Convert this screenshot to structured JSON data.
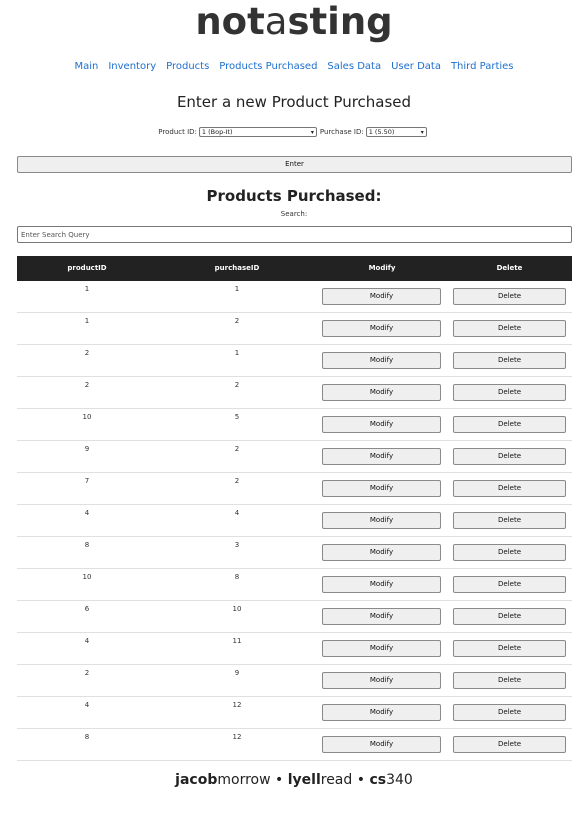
{
  "logo": {
    "bold1": "not",
    "light": "a",
    "bold2": "sting"
  },
  "nav": [
    "Main",
    "Inventory",
    "Products",
    "Products Purchased",
    "Sales Data",
    "User Data",
    "Third Parties"
  ],
  "new_heading": "Enter a new Product Purchased",
  "form": {
    "product_label": "Product ID:",
    "product_value": "1 (Bop-It)",
    "purchase_label": "Purchase ID:",
    "purchase_value": "1 (5.50)",
    "enter_label": "Enter"
  },
  "list_heading": "Products Purchased:",
  "search": {
    "label": "Search:",
    "placeholder": "Enter Search Query"
  },
  "table": {
    "headers": [
      "productID",
      "purchaseID",
      "Modify",
      "Delete"
    ],
    "modify_label": "Modify",
    "delete_label": "Delete",
    "rows": [
      [
        "1",
        "1"
      ],
      [
        "1",
        "2"
      ],
      [
        "2",
        "1"
      ],
      [
        "2",
        "2"
      ],
      [
        "10",
        "5"
      ],
      [
        "9",
        "2"
      ],
      [
        "7",
        "2"
      ],
      [
        "4",
        "4"
      ],
      [
        "8",
        "3"
      ],
      [
        "10",
        "8"
      ],
      [
        "6",
        "10"
      ],
      [
        "4",
        "11"
      ],
      [
        "2",
        "9"
      ],
      [
        "4",
        "12"
      ],
      [
        "8",
        "12"
      ]
    ]
  },
  "footer": {
    "a_bold": "jacob",
    "a_rest": "morrow",
    "sep1": " • ",
    "b_bold": "lyell",
    "b_rest": "read",
    "sep2": " • ",
    "c_bold": "cs",
    "c_rest": "340"
  }
}
